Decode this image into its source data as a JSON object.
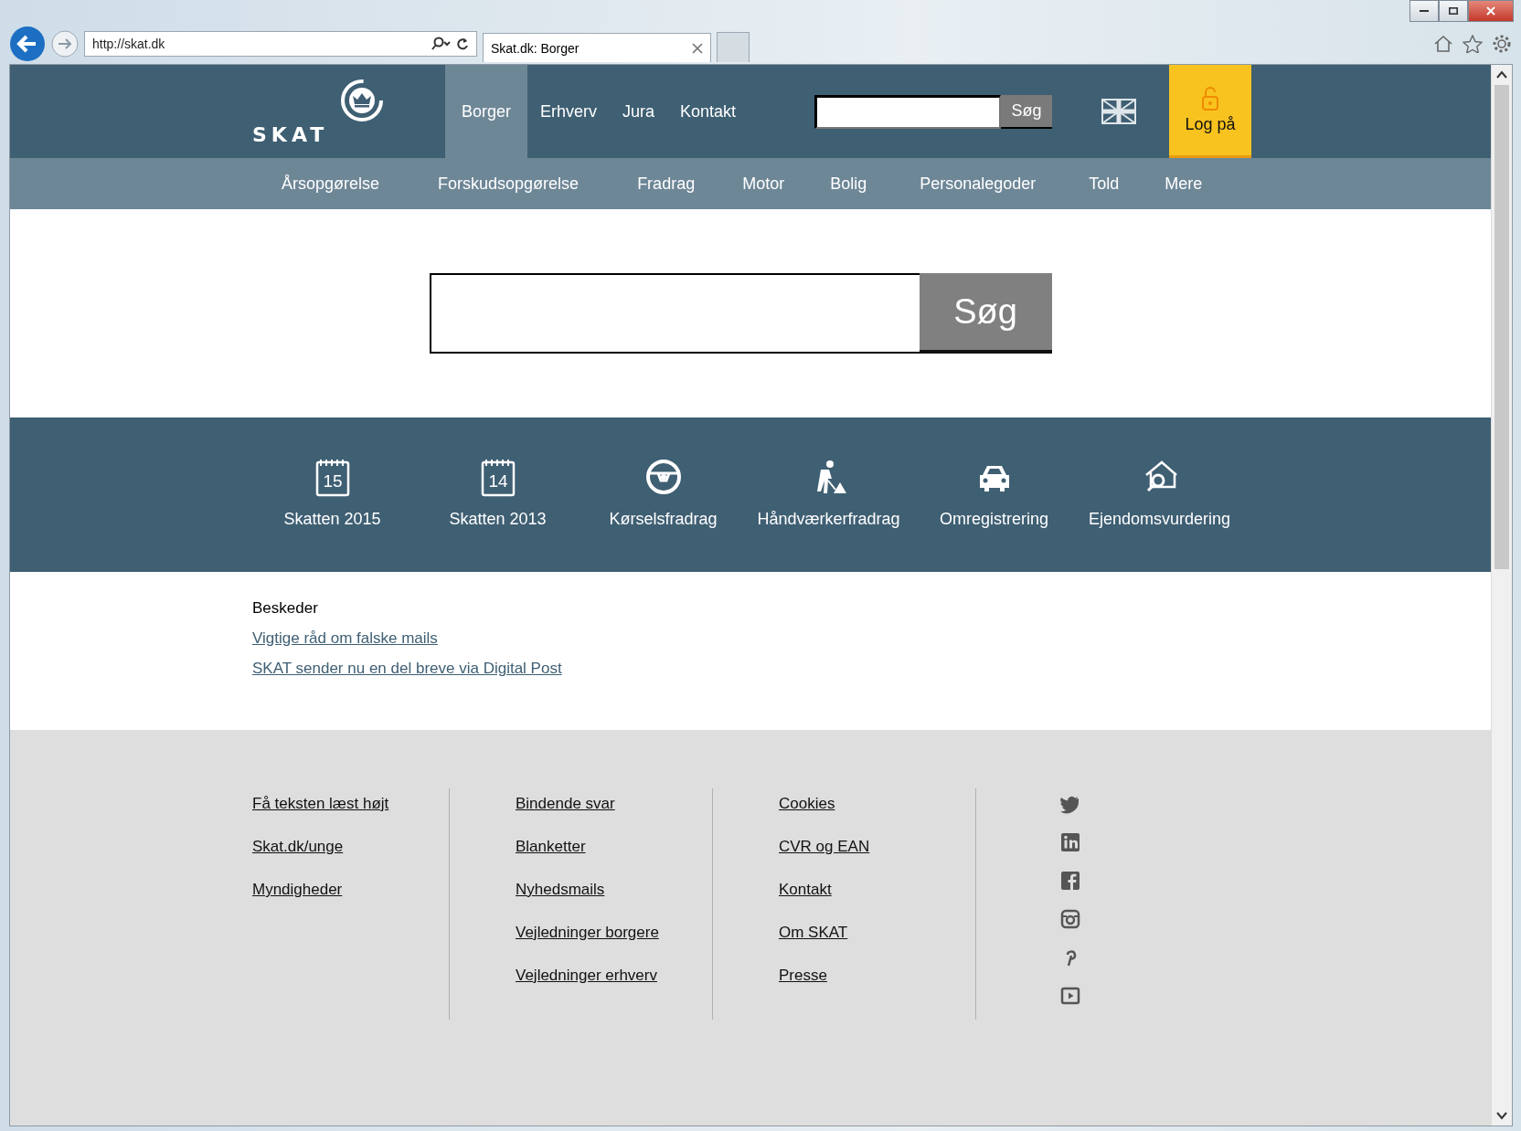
{
  "browser": {
    "address": "http://skat.dk",
    "tab_title": "Skat.dk: Borger"
  },
  "header": {
    "logo_text": "SKAT",
    "nav": [
      {
        "label": "Borger",
        "selected": true
      },
      {
        "label": "Erhverv",
        "selected": false
      },
      {
        "label": "Jura",
        "selected": false
      },
      {
        "label": "Kontakt",
        "selected": false
      }
    ],
    "search_button": "Søg",
    "login": "Log på"
  },
  "subnav": [
    "Årsopgørelse",
    "Forskudsopgørelse",
    "Fradrag",
    "Motor",
    "Bolig",
    "Personalegoder",
    "Told",
    "Mere"
  ],
  "search": {
    "button": "Søg"
  },
  "shortcuts": [
    {
      "label": "Skatten 2015",
      "kind": "calendar",
      "day": "15"
    },
    {
      "label": "Skatten 2013",
      "kind": "calendar",
      "day": "14"
    },
    {
      "label": "Kørselsfradrag",
      "kind": "wheel"
    },
    {
      "label": "Håndværkerfradrag",
      "kind": "worker"
    },
    {
      "label": "Omregistrering",
      "kind": "car"
    },
    {
      "label": "Ejendomsvurdering",
      "kind": "house"
    }
  ],
  "messages": {
    "heading": "Beskeder",
    "links": [
      "Vigtige råd om falske mails",
      "SKAT sender nu en del breve via Digital Post"
    ]
  },
  "footer": {
    "columns": [
      [
        "Få teksten læst højt",
        "Skat.dk/unge",
        "Myndigheder"
      ],
      [
        "Bindende svar",
        "Blanketter",
        "Nyhedsmails",
        "Vejledninger borgere",
        "Vejledninger erhverv"
      ],
      [
        "Cookies",
        "CVR og EAN",
        "Kontakt",
        "Om SKAT",
        "Presse"
      ]
    ],
    "social": [
      {
        "kind": "bird"
      },
      {
        "kind": "in"
      },
      {
        "kind": "f"
      },
      {
        "kind": "camera"
      },
      {
        "kind": "pin"
      },
      {
        "kind": "play"
      }
    ]
  }
}
